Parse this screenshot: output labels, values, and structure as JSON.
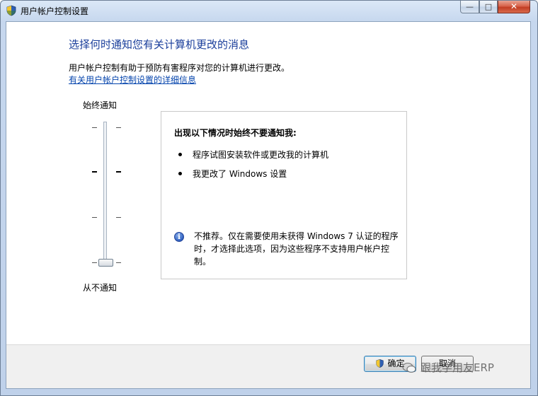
{
  "window": {
    "title": "用户帐户控制设置",
    "controls": {
      "minimize": "—",
      "maximize": "□",
      "close": "✕"
    }
  },
  "main": {
    "heading": "选择何时通知您有关计算机更改的消息",
    "description": "用户帐户控制有助于预防有害程序对您的计算机进行更改。",
    "link": "有关用户帐户控制设置的详细信息"
  },
  "slider": {
    "top_label": "始终通知",
    "bottom_label": "从不通知",
    "levels": 4,
    "selected_level": 1
  },
  "info": {
    "title": "出现以下情况时始终不要通知我:",
    "bullets": [
      "程序试图安装软件或更改我的计算机",
      "我更改了 Windows 设置"
    ],
    "note_icon": "info-icon",
    "note": "不推荐。仅在需要使用未获得 Windows 7 认证的程序时，才选择此选项，因为这些程序不支持用户帐户控制。"
  },
  "buttons": {
    "ok": "确定",
    "cancel": "取消"
  },
  "watermark": "跟我学用友ERP",
  "colors": {
    "heading": "#1a3e9b",
    "link": "#0645ad",
    "close_button": "#c23e24"
  }
}
